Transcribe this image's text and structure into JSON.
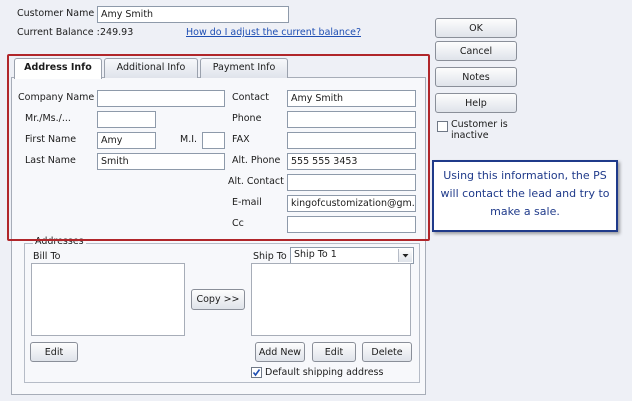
{
  "header": {
    "customer_name_label": "Customer Name",
    "customer_name_value": "Amy Smith",
    "current_balance_label": "Current Balance :",
    "current_balance_value": "249.93",
    "adjust_balance_link": "How do I adjust the current balance?"
  },
  "tabs": [
    {
      "label": "Address Info",
      "active": true
    },
    {
      "label": "Additional Info",
      "active": false
    },
    {
      "label": "Payment Info",
      "active": false
    }
  ],
  "address_info": {
    "company_name_label": "Company Name",
    "company_name_value": "",
    "salutation_label": "Mr./Ms./...",
    "salutation_value": "",
    "first_name_label": "First Name",
    "first_name_value": "Amy",
    "mi_label": "M.I.",
    "mi_value": "",
    "last_name_label": "Last Name",
    "last_name_value": "Smith",
    "contact_label": "Contact",
    "contact_value": "Amy Smith",
    "phone_label": "Phone",
    "phone_value": "",
    "fax_label": "FAX",
    "fax_value": "",
    "alt_phone_label": "Alt. Phone",
    "alt_phone_value": "555 555 3453",
    "alt_contact_label": "Alt. Contact",
    "alt_contact_value": "",
    "email_label": "E-mail",
    "email_value": "kingofcustomization@gm...",
    "cc_label": "Cc",
    "cc_value": ""
  },
  "addresses": {
    "section_label": "Addresses",
    "bill_to_label": "Bill To",
    "ship_to_label": "Ship To",
    "ship_to_selected": "Ship To 1",
    "copy_button": "Copy >>",
    "edit_bill_button": "Edit",
    "add_new_button": "Add New",
    "edit_ship_button": "Edit",
    "delete_button": "Delete",
    "default_shipping_label": "Default shipping address",
    "default_shipping_checked": true
  },
  "side_buttons": {
    "ok": "OK",
    "cancel": "Cancel",
    "notes": "Notes",
    "help": "Help",
    "customer_inactive_label": "Customer is inactive",
    "customer_inactive_checked": false
  },
  "callout": {
    "text": "Using this information, the PS will contact the lead and try to make a sale."
  },
  "colors": {
    "highlight_border": "#b0262a",
    "callout_border": "#1f3a8a",
    "link": "#1f4fb3"
  }
}
